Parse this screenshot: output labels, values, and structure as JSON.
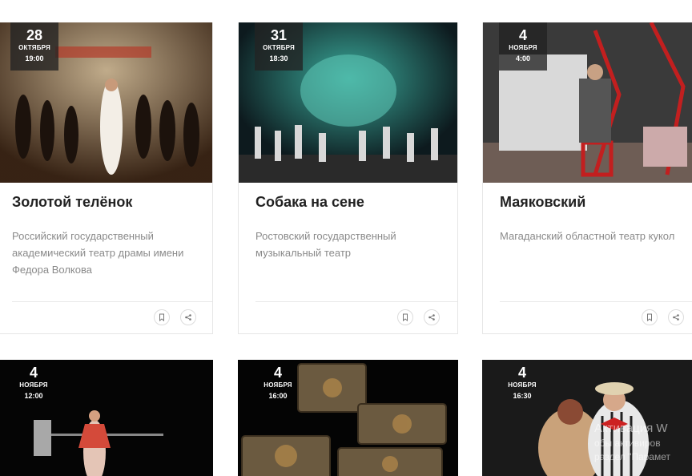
{
  "events": [
    {
      "day": "28",
      "month": "ОКТЯБРЯ",
      "time": "19:00",
      "title": "Золотой телёнок",
      "venue": "Российский государственный академический театр драмы имени Федора Волкова",
      "image": "theatre-dance-scene"
    },
    {
      "day": "31",
      "month": "ОКТЯБРЯ",
      "time": "18:30",
      "title": "Собака на сене",
      "venue": "Ростовский государственный музыкальный театр",
      "image": "theatre-costume-ensemble"
    },
    {
      "day": "4",
      "month": "НОЯБРЯ",
      "time": "4:00",
      "title": "Маяковский",
      "venue": "Магаданский областной театр кукол",
      "image": "theatre-red-frame-stage"
    },
    {
      "day": "4",
      "month": "НОЯБРЯ",
      "time": "12:00",
      "title": "",
      "venue": "",
      "image": "theatre-dark-stage-actress"
    },
    {
      "day": "4",
      "month": "НОЯБРЯ",
      "time": "16:00",
      "title": "",
      "venue": "",
      "image": "ornate-treasure-chests"
    },
    {
      "day": "4",
      "month": "НОЯБРЯ",
      "time": "16:30",
      "title": "",
      "venue": "",
      "image": "theatre-couple-costume"
    }
  ],
  "icons": {
    "bookmark": "bookmark-icon",
    "share": "share-icon"
  },
  "watermark": {
    "line1": "Активация W",
    "line2": "обы активиров",
    "line3": "раздел \"Парамет"
  }
}
